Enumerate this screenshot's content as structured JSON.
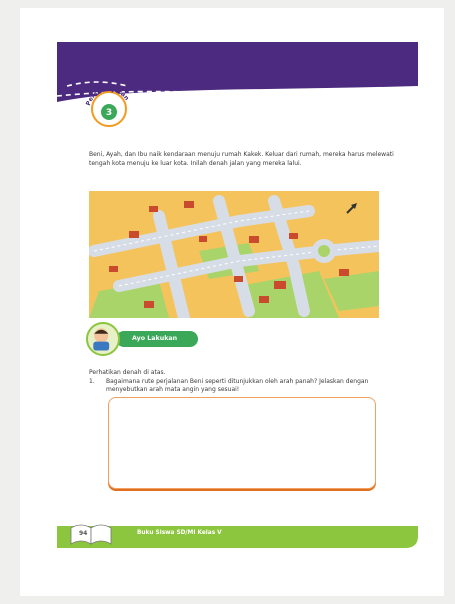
{
  "header": {
    "badge_label": "Pembelajaran",
    "badge_number": "3"
  },
  "intro_text": "Beni, Ayah, dan Ibu naik kendaraan menuju rumah Kakek. Keluar dari rumah, mereka harus melewati tengah kota menuju ke luar kota. Inilah denah jalan yang mereka lalui.",
  "ayo": {
    "label": "Ayo Lakukan"
  },
  "questions": {
    "intro": "Perhatikan denah di atas.",
    "items": [
      {
        "number": "1.",
        "text": "Bagaimana rute perjalanan Beni seperti ditunjukkan oleh arah panah? Jelaskan dengan menyebutkan arah mata angin yang sesuai!"
      }
    ]
  },
  "footer": {
    "page_number": "94",
    "book_title": "Buku Siswa SD/MI Kelas V"
  },
  "colors": {
    "header_purple": "#4b2a7f",
    "accent_orange": "#f39a1f",
    "badge_green": "#3aa858",
    "footer_green": "#8cc63f",
    "map_ground": "#f5c35c",
    "map_road": "#d7dde6",
    "map_grass": "#a9d46a"
  },
  "icons": {
    "arrow": "route-arrow-icon",
    "avatar": "student-avatar-icon",
    "book": "book-icon"
  }
}
